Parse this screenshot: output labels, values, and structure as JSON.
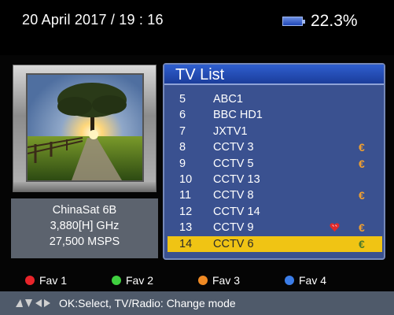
{
  "header": {
    "datetime": "20 April 2017 / 19 : 16",
    "battery_percent": "22.3%",
    "battery_icon": "battery-icon"
  },
  "satellite": {
    "name": "ChinaSat 6B",
    "frequency": "3,880[H] GHz",
    "symbol_rate": "27,500 MSPS"
  },
  "tv_list": {
    "title": "TV List",
    "channels": [
      {
        "num": "5",
        "name": "ABC1",
        "fav": false,
        "scrambled": ""
      },
      {
        "num": "6",
        "name": "BBC HD1",
        "fav": false,
        "scrambled": ""
      },
      {
        "num": "7",
        "name": "JXTV1",
        "fav": false,
        "scrambled": ""
      },
      {
        "num": "8",
        "name": "CCTV 3",
        "fav": false,
        "scrambled": "€"
      },
      {
        "num": "9",
        "name": "CCTV 5",
        "fav": false,
        "scrambled": "€"
      },
      {
        "num": "10",
        "name": "CCTV 13",
        "fav": false,
        "scrambled": ""
      },
      {
        "num": "11",
        "name": "CCTV 8",
        "fav": false,
        "scrambled": "€"
      },
      {
        "num": "12",
        "name": "CCTV 14",
        "fav": false,
        "scrambled": ""
      },
      {
        "num": "13",
        "name": "CCTV 9",
        "fav": true,
        "scrambled": "€"
      },
      {
        "num": "14",
        "name": "CCTV 6",
        "fav": false,
        "scrambled": "€",
        "selected": true
      }
    ]
  },
  "favorites": [
    {
      "label": "Fav 1",
      "color": "#e8242a"
    },
    {
      "label": "Fav 2",
      "color": "#3fcf3f"
    },
    {
      "label": "Fav 3",
      "color": "#f08a24"
    },
    {
      "label": "Fav 4",
      "color": "#3b7de8"
    }
  ],
  "help": {
    "text": "OK:Select, TV/Radio: Change mode",
    "icon": "navigation-arrows-icon"
  },
  "colors": {
    "selection": "#f0c414",
    "list_panel": "#3a5190",
    "list_title": "#2f5fcf",
    "scrambled": "#f0a030"
  }
}
